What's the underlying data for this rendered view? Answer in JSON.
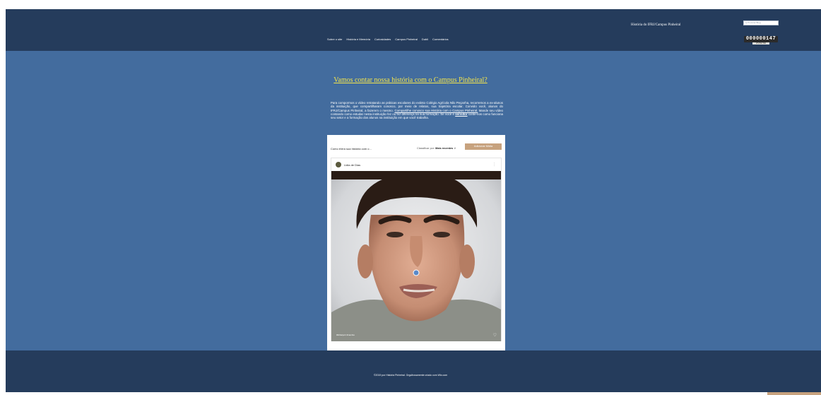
{
  "header": {
    "nav": [
      "Sobre o site",
      "História e Memória",
      "Curiosidades",
      "Campus Pinheiral",
      "Dubli",
      "Comentários"
    ],
    "site_title": "História do IFRJ/Campus Pinheiral",
    "search_placeholder": "Q Procurar Blog",
    "counter": "000000147",
    "counter_label": "VISITANTES"
  },
  "main": {
    "headline": "Vamos contar nossa história com o Campus Pinheiral?",
    "para_1": "Para compormos o vídeo retratando as práticas escolares do extinto Colégio Agrícola Nilo Peçanha, recorremos a ex-alunos da instituição, que compartilharam conosco, por meio de relatos, sua trajetória escolar. Convido você, alunos do IFRJ/Campus Pinheiral, a fazerem o mesmo.",
    "para_link_1": "Compartilhe conosco sua História com o Campus Pinheiral.",
    "para_2": "Mande seu vídeo contando como estudar nesta instituição fez ou fez diferença na sua formação. Se você é",
    "para_bold": "servidor",
    "para_3": "conte-nos como funciona seu setor e a formação dos alunos na instituição em que você trabalha."
  },
  "card": {
    "title": "Como é/era sua história com o...",
    "sort_label": "Classificar por:",
    "sort_value": "Mais recentes",
    "add_button": "Adicionar Mídia",
    "post_author": "Lidia de Dias",
    "post_more": "⋮",
    "post_tags": "#tbtfeitpcir #cambio",
    "like_icon": "♡"
  },
  "footer": {
    "text": "©2019 por História Pinheiral. Orgulhosamente criado com Wix.com"
  }
}
